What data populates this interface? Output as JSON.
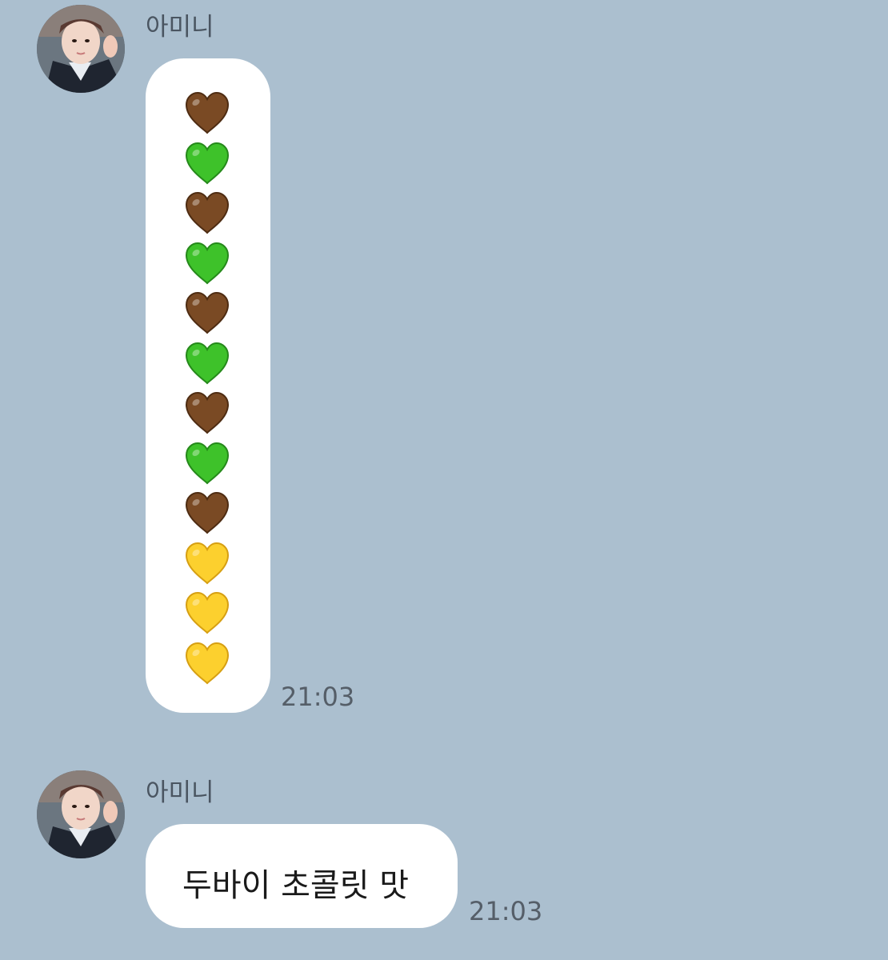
{
  "messages": [
    {
      "sender": "아미니",
      "avatar": "profile-photo",
      "content_type": "emoji",
      "emojis": [
        "🤎",
        "💚",
        "🤎",
        "💚",
        "🤎",
        "💚",
        "🤎",
        "💚",
        "🤎",
        "💛",
        "💛",
        "💛"
      ],
      "time": "21:03"
    },
    {
      "sender": "아미니",
      "avatar": "profile-photo",
      "content_type": "text",
      "text": "두바이 초콜릿 맛",
      "time": "21:03"
    }
  ],
  "colors": {
    "background": "#abbfcf",
    "bubble": "#ffffff",
    "heart_brown": "#7a4a24",
    "heart_green": "#3ec22a",
    "heart_yellow": "#fcd02e"
  }
}
